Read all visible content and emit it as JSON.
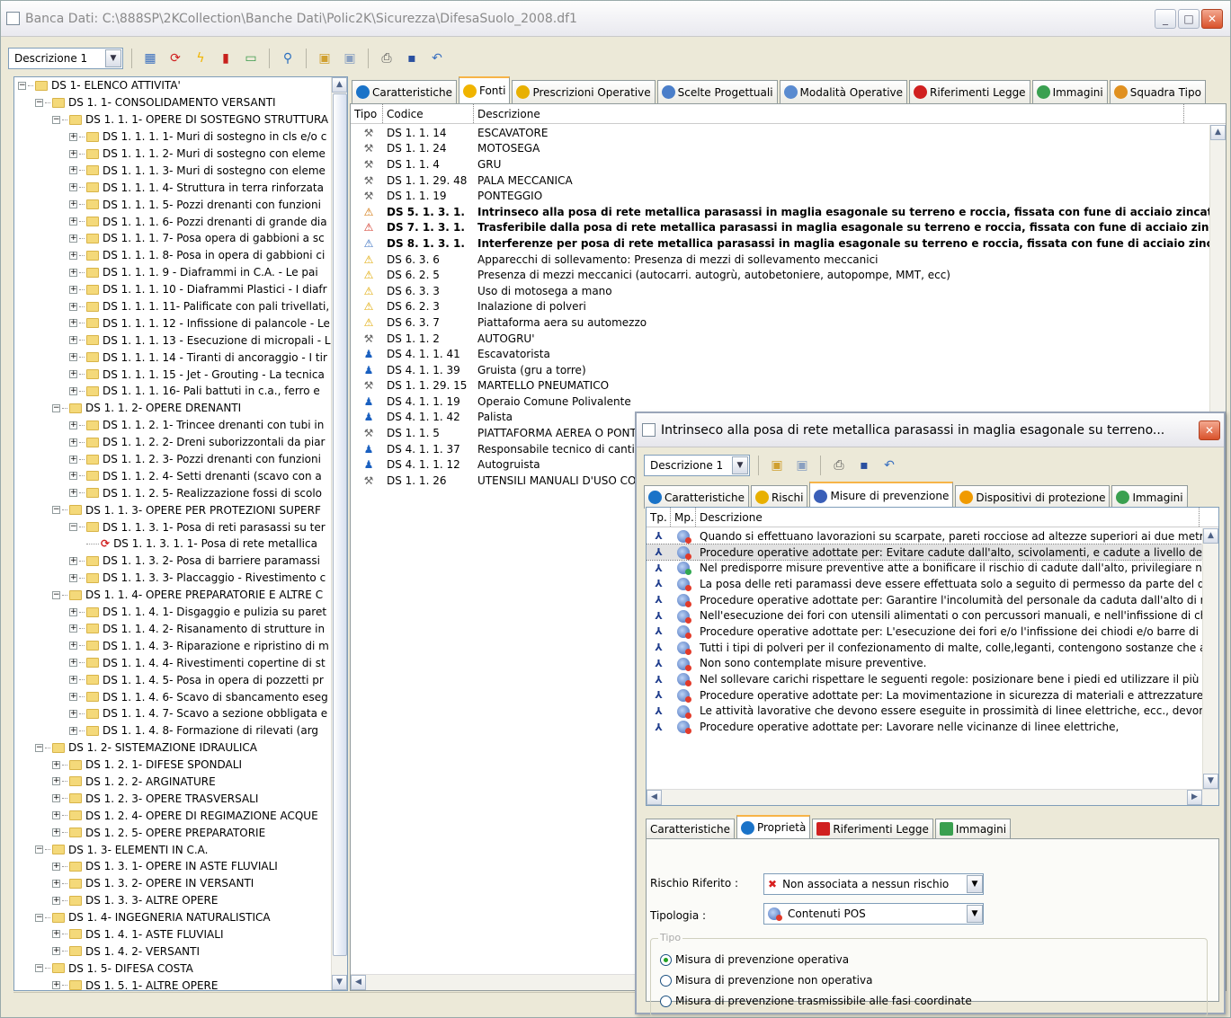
{
  "window": {
    "title": "Banca Dati: C:\\888SP\\2KCollection\\Banche Dati\\Polic2K\\Sicurezza\\DifesaSuolo_2008.df1"
  },
  "toolbar": {
    "combo_value": "Descrizione 1"
  },
  "tree": [
    {
      "lvl": 0,
      "pm": "−",
      "label": "DS  1- ELENCO ATTIVITA'"
    },
    {
      "lvl": 1,
      "pm": "−",
      "label": "DS  1.  1- CONSOLIDAMENTO VERSANTI"
    },
    {
      "lvl": 2,
      "pm": "−",
      "label": "DS  1.  1.  1- OPERE DI SOSTEGNO STRUTTURA"
    },
    {
      "lvl": 3,
      "pm": "+",
      "label": "DS  1.  1.  1.  1- Muri di sostegno in cls e/o c"
    },
    {
      "lvl": 3,
      "pm": "+",
      "label": "DS  1.  1.  1.  2- Muri di sostegno con eleme"
    },
    {
      "lvl": 3,
      "pm": "+",
      "label": "DS  1.  1.  1.  3- Muri di sostegno con eleme"
    },
    {
      "lvl": 3,
      "pm": "+",
      "label": "DS  1.  1.  1.  4- Struttura in terra rinforzata"
    },
    {
      "lvl": 3,
      "pm": "+",
      "label": "DS  1.  1.  1.  5- Pozzi drenanti con funzioni"
    },
    {
      "lvl": 3,
      "pm": "+",
      "label": "DS  1.  1.  1.  6- Pozzi drenanti di grande dia"
    },
    {
      "lvl": 3,
      "pm": "+",
      "label": "DS  1.  1.  1.  7- Posa opera di gabbioni a sc"
    },
    {
      "lvl": 3,
      "pm": "+",
      "label": "DS  1.  1.  1.  8- Posa in opera di gabbioni ci"
    },
    {
      "lvl": 3,
      "pm": "+",
      "label": "DS  1.  1.  1.  9 - Diaframmi  in  C.A. - Le pai"
    },
    {
      "lvl": 3,
      "pm": "+",
      "label": "DS  1.  1.  1. 10 - Diaframmi  Plastici - I diafr"
    },
    {
      "lvl": 3,
      "pm": "+",
      "label": "DS  1.  1.  1. 11- Palificate con pali trivellati,"
    },
    {
      "lvl": 3,
      "pm": "+",
      "label": "DS  1.  1.  1. 12 - Infissione di palancole - Le"
    },
    {
      "lvl": 3,
      "pm": "+",
      "label": "DS  1.  1.  1. 13 - Esecuzione di micropali - L"
    },
    {
      "lvl": 3,
      "pm": "+",
      "label": "DS  1.  1.  1. 14 - Tiranti di ancoraggio - I tir"
    },
    {
      "lvl": 3,
      "pm": "+",
      "label": "DS  1.  1.  1. 15 - Jet - Grouting - La tecnica"
    },
    {
      "lvl": 3,
      "pm": "+",
      "label": "DS  1.  1.  1. 16- Pali battuti in c.a., ferro e"
    },
    {
      "lvl": 2,
      "pm": "−",
      "label": "DS  1.  1.  2- OPERE DRENANTI"
    },
    {
      "lvl": 3,
      "pm": "+",
      "label": "DS  1.  1.  2.  1- Trincee drenanti con tubi in"
    },
    {
      "lvl": 3,
      "pm": "+",
      "label": "DS  1.  1.  2.  2- Dreni suborizzontali da piar"
    },
    {
      "lvl": 3,
      "pm": "+",
      "label": "DS  1.  1.  2.  3- Pozzi drenanti con funzioni"
    },
    {
      "lvl": 3,
      "pm": "+",
      "label": "DS  1.  1.  2.  4- Setti drenanti (scavo con a"
    },
    {
      "lvl": 3,
      "pm": "+",
      "label": "DS  1.  1.  2.  5- Realizzazione fossi di scolo"
    },
    {
      "lvl": 2,
      "pm": "−",
      "label": "DS  1.  1.  3- OPERE PER PROTEZIONI SUPERF"
    },
    {
      "lvl": 3,
      "pm": "−",
      "label": "DS  1.  1.  3.  1- Posa di reti parasassi su ter"
    },
    {
      "lvl": 4,
      "pm": "",
      "leaf": true,
      "label": "DS  1.  1.  3.  1.  1- Posa di rete metallica"
    },
    {
      "lvl": 3,
      "pm": "+",
      "label": "DS  1.  1.  3.  2- Posa di barriere paramassi"
    },
    {
      "lvl": 3,
      "pm": "+",
      "label": "DS  1.  1.  3.  3- Placcaggio - Rivestimento c"
    },
    {
      "lvl": 2,
      "pm": "−",
      "label": "DS  1.  1.  4- OPERE PREPARATORIE E ALTRE C"
    },
    {
      "lvl": 3,
      "pm": "+",
      "label": "DS  1.  1.  4.  1- Disgaggio e pulizia su paret"
    },
    {
      "lvl": 3,
      "pm": "+",
      "label": "DS  1.  1.  4.  2- Risanamento di strutture in"
    },
    {
      "lvl": 3,
      "pm": "+",
      "label": "DS  1.  1.  4.  3- Riparazione e ripristino di m"
    },
    {
      "lvl": 3,
      "pm": "+",
      "label": "DS  1.  1.  4.  4- Rivestimenti copertine di st"
    },
    {
      "lvl": 3,
      "pm": "+",
      "label": "DS  1.  1.  4.  5- Posa in opera di pozzetti pr"
    },
    {
      "lvl": 3,
      "pm": "+",
      "label": "DS  1.  1.  4.  6- Scavo di sbancamento eseg"
    },
    {
      "lvl": 3,
      "pm": "+",
      "label": "DS  1.  1.  4.  7- Scavo a sezione obbligata e"
    },
    {
      "lvl": 3,
      "pm": "+",
      "label": "DS  1.  1.  4.  8- Formazione di  rilevati  (arg"
    },
    {
      "lvl": 1,
      "pm": "−",
      "label": "DS  1.  2- SISTEMAZIONE IDRAULICA"
    },
    {
      "lvl": 2,
      "pm": "+",
      "label": "DS  1.  2.  1- DIFESE SPONDALI"
    },
    {
      "lvl": 2,
      "pm": "+",
      "label": "DS  1.  2.  2- ARGINATURE"
    },
    {
      "lvl": 2,
      "pm": "+",
      "label": "DS  1.  2.  3- OPERE TRASVERSALI"
    },
    {
      "lvl": 2,
      "pm": "+",
      "label": "DS  1.  2.  4- OPERE DI REGIMAZIONE ACQUE"
    },
    {
      "lvl": 2,
      "pm": "+",
      "label": "DS  1.  2.  5- OPERE PREPARATORIE"
    },
    {
      "lvl": 1,
      "pm": "−",
      "label": "DS  1.  3- ELEMENTI IN C.A."
    },
    {
      "lvl": 2,
      "pm": "+",
      "label": "DS  1.  3.  1- OPERE IN ASTE FLUVIALI"
    },
    {
      "lvl": 2,
      "pm": "+",
      "label": "DS  1.  3.  2- OPERE IN VERSANTI"
    },
    {
      "lvl": 2,
      "pm": "+",
      "label": "DS  1.  3.  3- ALTRE OPERE"
    },
    {
      "lvl": 1,
      "pm": "−",
      "label": "DS  1.  4- INGEGNERIA NATURALISTICA"
    },
    {
      "lvl": 2,
      "pm": "+",
      "label": "DS  1.  4.  1- ASTE FLUVIALI"
    },
    {
      "lvl": 2,
      "pm": "+",
      "label": "DS  1.  4.  2- VERSANTI"
    },
    {
      "lvl": 1,
      "pm": "−",
      "label": "DS  1.  5- DIFESA COSTA"
    },
    {
      "lvl": 2,
      "pm": "+",
      "label": "DS  1.  5.  1- ALTRE OPERE"
    }
  ],
  "main_tabs": [
    {
      "label": "Caratteristiche",
      "icon": "info-icon",
      "color": "#1a73c8"
    },
    {
      "label": "Fonti",
      "icon": "lightning-icon",
      "color": "#f0b400",
      "active": true
    },
    {
      "label": "Prescrizioni Operative",
      "icon": "warning-icon",
      "color": "#e8b000"
    },
    {
      "label": "Scelte Progettuali",
      "icon": "design-icon",
      "color": "#4a7ec9"
    },
    {
      "label": "Modalità Operative",
      "icon": "window-icon",
      "color": "#5a8bd0"
    },
    {
      "label": "Riferimenti Legge",
      "icon": "book-icon",
      "color": "#d02020"
    },
    {
      "label": "Immagini",
      "icon": "image-icon",
      "color": "#3aa050"
    },
    {
      "label": "Squadra Tipo",
      "icon": "team-icon",
      "color": "#e09020"
    }
  ],
  "grid": {
    "headers": {
      "tipo": "Tipo",
      "codice": "Codice",
      "descrizione": "Descrizione"
    },
    "rows": [
      {
        "icon": "tools-icon",
        "glyph": "⚒",
        "codice": "DS  1.  1. 14",
        "desc": "ESCAVATORE"
      },
      {
        "icon": "tools-icon",
        "glyph": "⚒",
        "codice": "DS  1.  1. 24",
        "desc": "MOTOSEGA"
      },
      {
        "icon": "tools-icon",
        "glyph": "⚒",
        "codice": "DS  1.  1.  4",
        "desc": "GRU"
      },
      {
        "icon": "tools-icon",
        "glyph": "⚒",
        "codice": "DS  1.  1. 29. 48",
        "desc": "PALA MECCANICA"
      },
      {
        "icon": "tools-icon",
        "glyph": "⚒",
        "codice": "DS  1.  1. 19",
        "desc": "PONTEGGIO"
      },
      {
        "icon": "risk-icon",
        "glyph": "⚠",
        "codice": "DS  5.  1.  3.  1.",
        "desc": "Intrinseco alla posa di rete metallica parasassi  in maglia esagonale su  terreno e  roccia, fissata con fune di acciaio zincato",
        "bold": true
      },
      {
        "icon": "transfer-risk-icon",
        "glyph": "⚠",
        "codice": "DS  7.  1.  3.  1.",
        "desc": "Trasferibile dalla posa di rete metallica parasassi  in maglia esagonale su  terreno e  roccia, fissata con fune di acciaio zincato",
        "bold": true
      },
      {
        "icon": "interference-icon",
        "glyph": "⚠",
        "codice": "DS  8.  1.  3.  1.",
        "desc": "Interferenze per posa di rete metallica parasassi  in maglia esagonale su  terreno e  roccia, fissata con fune di acciaio zincato",
        "bold": true
      },
      {
        "icon": "warning-icon",
        "glyph": "⚠",
        "codice": "DS  6.  3.  6",
        "desc": "Apparecchi di sollevamento: Presenza di mezzi di sollevamento meccanici"
      },
      {
        "icon": "warning-icon",
        "glyph": "⚠",
        "codice": "DS  6.  2.  5",
        "desc": "Presenza di mezzi meccanici (autocarri. autogrù, autobetoniere, autopompe, MMT, ecc)"
      },
      {
        "icon": "warning-icon",
        "glyph": "⚠",
        "codice": "DS  6.  3.  3",
        "desc": "Uso di motosega a mano"
      },
      {
        "icon": "warning-icon",
        "glyph": "⚠",
        "codice": "DS  6.  2.  3",
        "desc": "Inalazione di polveri"
      },
      {
        "icon": "warning-icon",
        "glyph": "⚠",
        "codice": "DS  6.  3.  7",
        "desc": "Piattaforma aera su automezzo"
      },
      {
        "icon": "tools-icon",
        "glyph": "⚒",
        "codice": "DS  1.  1.  2",
        "desc": "AUTOGRU'"
      },
      {
        "icon": "worker-icon",
        "glyph": "♟",
        "codice": "DS  4.  1.  1. 41",
        "desc": "Escavatorista"
      },
      {
        "icon": "worker-icon",
        "glyph": "♟",
        "codice": "DS  4.  1.  1. 39",
        "desc": "Gruista (gru a torre)"
      },
      {
        "icon": "tools-icon",
        "glyph": "⚒",
        "codice": "DS  1.  1. 29. 15",
        "desc": "MARTELLO PNEUMATICO"
      },
      {
        "icon": "worker-icon",
        "glyph": "♟",
        "codice": "DS  4.  1.  1. 19",
        "desc": "Operaio Comune Polivalente"
      },
      {
        "icon": "worker-icon",
        "glyph": "♟",
        "codice": "DS  4.  1.  1. 42",
        "desc": "Palista"
      },
      {
        "icon": "tools-icon",
        "glyph": "⚒",
        "codice": "DS  1.  1.  5",
        "desc": "PIATTAFORMA AEREA O PONT"
      },
      {
        "icon": "worker-icon",
        "glyph": "♟",
        "codice": "DS  4.  1.  1. 37",
        "desc": "Responsabile tecnico di cantiere"
      },
      {
        "icon": "worker-icon",
        "glyph": "♟",
        "codice": "DS  4.  1.  1. 12",
        "desc": "Autogruista"
      },
      {
        "icon": "tools-icon",
        "glyph": "⚒",
        "codice": "DS  1.  1. 26",
        "desc": "UTENSILI MANUALI D'USO CON"
      }
    ]
  },
  "popup": {
    "title": "Intrinseco alla posa di rete metallica parasassi  in maglia esagonale su  terreno...",
    "combo_value": "Descrizione 1",
    "tabs": [
      {
        "label": "Caratteristiche",
        "color": "#1a73c8"
      },
      {
        "label": "Rischi",
        "color": "#e8b000"
      },
      {
        "label": "Misure di prevenzione",
        "color": "#3a5fb8",
        "active": true
      },
      {
        "label": "Dispositivi di protezione",
        "color": "#f09a00"
      },
      {
        "label": "Immagini",
        "color": "#3aa050"
      }
    ],
    "list_headers": {
      "tp": "Tp.",
      "mp": "Mp.",
      "descrizione": "Descrizione"
    },
    "list": [
      {
        "desc": "Quando si effettuano lavorazioni su scarpate, pareti rocciose ad altezze superiori ai due metri bisogna",
        "mp": "red"
      },
      {
        "desc": "Procedure operative adottate per: Evitare cadute dall'alto, scivolamenti, e cadute a livello degli operai",
        "mp": "red",
        "sel": true
      },
      {
        "desc": "Nel predisporre misure preventive atte a bonificare il rischio di cadute dall'alto, privilegiare  nel limite",
        "mp": "green"
      },
      {
        "desc": "La posa delle reti paramassi deve essere effettuata solo a seguito di  permesso da parte del direttore",
        "mp": "red"
      },
      {
        "desc": "Procedure operative adottate per: Garantire l'incolumità del personale da caduta dall'alto di materiale",
        "mp": "red"
      },
      {
        "desc": "Nell'esecuzione dei fori con utensili alimentati o con percussori manuali, e nell'infissione di chiodi e/o",
        "mp": "red"
      },
      {
        "desc": "Procedure operative adottate per: L'esecuzione dei fori  e/o l'infissione dei chiodi e/o barre di ancoraggio",
        "mp": "red"
      },
      {
        "desc": "Tutti i tipi di polveri per il confezionamento di malte, colle,leganti, contengono sostanze che a contatto",
        "mp": "red"
      },
      {
        "desc": "Non sono contemplate misure preventive.",
        "mp": "red"
      },
      {
        "desc": "Nel sollevare carichi rispettare le seguenti regole: posizionare bene i piedi ed utilizzare il più possibile",
        "mp": "red"
      },
      {
        "desc": "Procedure operative adottate per: La movimentazione in sicurezza di materiali e attrezzature",
        "mp": "red"
      },
      {
        "desc": "Le attività lavorative che devono essere eseguite in prossimità di linee elettriche, ecc., devono rispettare",
        "mp": "red"
      },
      {
        "desc": "Procedure operative adottate per: Lavorare nelle vicinanze di linee elettriche,",
        "mp": "red"
      }
    ],
    "prop_tabs": [
      {
        "label": "Caratteristiche"
      },
      {
        "label": "Proprietà",
        "active": true
      },
      {
        "label": "Riferimenti Legge"
      },
      {
        "label": "Immagini"
      }
    ],
    "props": {
      "rischio_label": "Rischio Riferito :",
      "rischio_value": "Non associata a nessun rischio",
      "tipologia_label": "Tipologia :",
      "tipologia_value": "Contenuti POS",
      "tipo_legend": "Tipo",
      "radios": [
        {
          "label": "Misura di prevenzione operativa",
          "checked": true
        },
        {
          "label": "Misura di prevenzione non operativa"
        },
        {
          "label": "Misura di prevenzione trasmissibile alle fasi coordinate"
        }
      ]
    }
  }
}
